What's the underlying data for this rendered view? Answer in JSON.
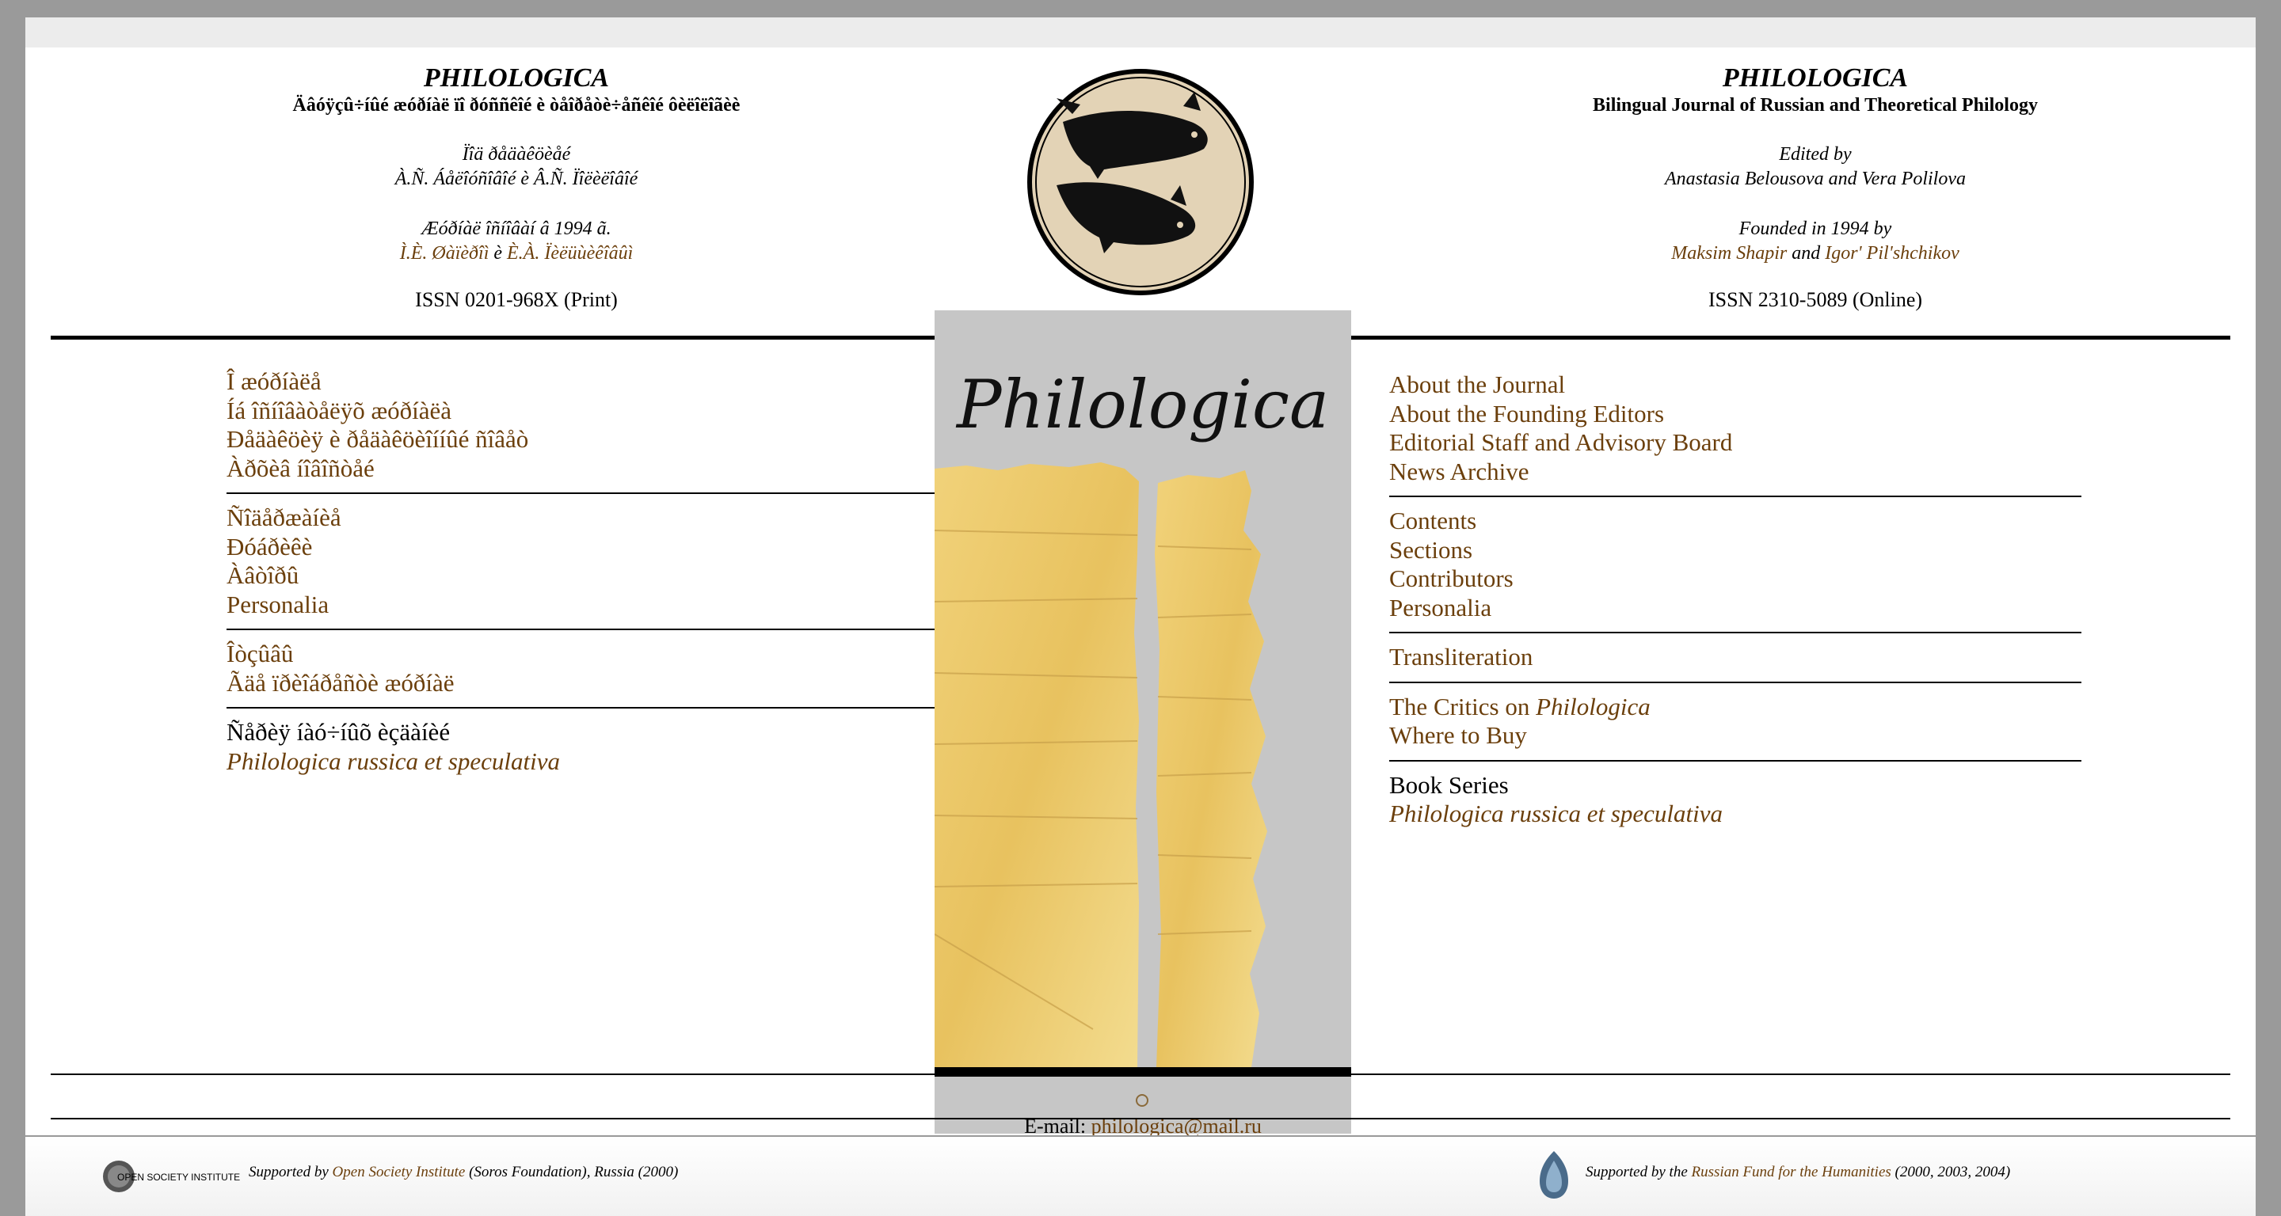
{
  "left_header": {
    "title": "PHILOLOGICA",
    "subtitle": "Äâóÿçû÷íûé æóðíàë ïî ðóññêîé è òåîðåòè÷åñêîé ôèëîëîãèè",
    "edited_by": "Ïîä ðåäàêöèåé",
    "editors": "À.Ñ. Áåëîóñîâîé è Â.Ñ. Ïîëèëîâîé",
    "founded": "Æóðíàë îñíîâàí â 1994 ã.",
    "founder1": "Ì.È. Øàïèðîì",
    "and": "è",
    "founder2": "È.À. Ïèëüùèêîâûì",
    "issn": "ISSN 0201-968X (Print)"
  },
  "right_header": {
    "title": "PHILOLOGICA",
    "subtitle": "Bilingual Journal of Russian and Theoretical Philology",
    "edited_by": "Edited by",
    "editors": "Anastasia Belousova and Vera Polilova",
    "founded": "Founded in 1994 by",
    "founder1": "Maksim Shapir",
    "and": "and",
    "founder2": "Igor' Pil'shchikov",
    "issn": "ISSN 2310-5089 (Online)"
  },
  "cover": {
    "title": "Philologica",
    "email_label": "E-mail:",
    "email": "philologica@mail.ru"
  },
  "left_menu": {
    "g1": [
      "Î æóðíàëå",
      "Íá îñíîâàòåëÿõ æóðíàëà",
      "Ðåäàêöèÿ è ðåäàêöèîííûé ñîâåò",
      "Àðõèâ íîâîñòåé"
    ],
    "g2": [
      "Ñîäåðæàíèå",
      "Ðóáðèêè",
      "Àâòîðû",
      "Personalia"
    ],
    "g3": [
      "Îòçûâû",
      "Ãäå ïðèîáðåñòè æóðíàë"
    ],
    "g4_plain": "Ñåðèÿ íàó÷íûõ èçäàíèé",
    "g4_link": "Philologica russica et speculativa"
  },
  "right_menu": {
    "g1": [
      "About the Journal",
      "About the Founding Editors",
      "Editorial Staff and Advisory Board",
      "News Archive"
    ],
    "g2": [
      "Contents",
      "Sections",
      "Contributors",
      "Personalia"
    ],
    "g3": [
      "Transliteration"
    ],
    "g4_prefix": "The Critics on ",
    "g4_ital": "Philologica",
    "g4_buy": "Where to Buy",
    "g5_plain": "Book Series",
    "g5_link": "Philologica russica et speculativa"
  },
  "footer": {
    "osi_logo_text": "OPEN SOCIETY INSTITUTE",
    "left_prefix": "Supported by ",
    "left_link": "Open Society Institute",
    "left_suffix": " (Soros Foundation), Russia (2000)",
    "right_prefix": "Supported by the ",
    "right_link": "Russian Fund for the Humanities",
    "right_suffix": " (2000, 2003, 2004)"
  },
  "colors": {
    "link": "#6b3f0c",
    "window_frame": "#9a9a9a"
  }
}
